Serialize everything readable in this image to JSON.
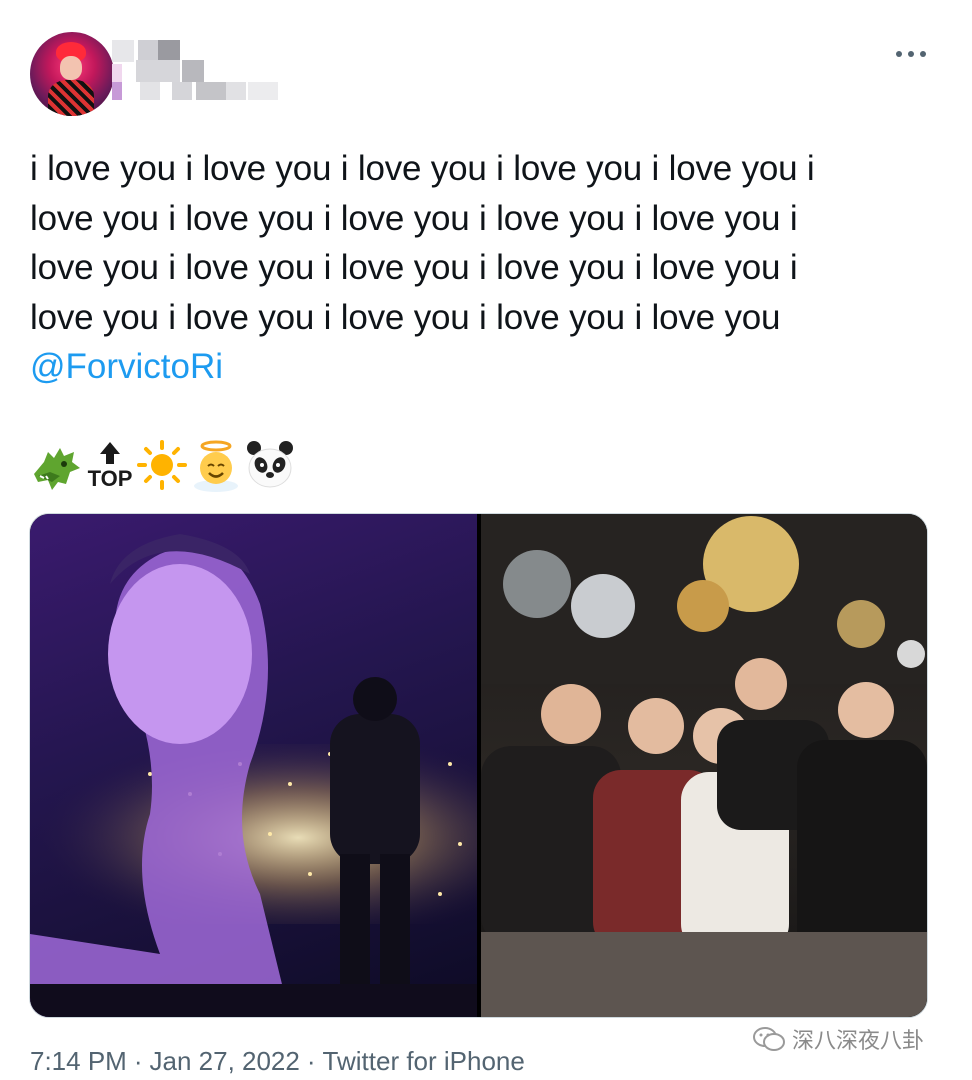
{
  "tweet": {
    "text_lines": [
      "i love you i love you i love you i love you i love you i",
      "love you i love you i love you i love you i love you i",
      "love you i love you i love you i love you i love you i",
      "love you i love you i love you i love you i love you"
    ],
    "mention": "@ForvictoRi",
    "emojis": [
      "dragon-face",
      "top-arrow",
      "sun",
      "angel-face",
      "panda-face"
    ],
    "emoji_top_label": "TOP",
    "time": "7:14 PM",
    "separator": "·",
    "date": "Jan 27, 2022",
    "source": "Twitter for iPhone"
  },
  "watermark": {
    "text": "深八深夜八卦"
  },
  "colors": {
    "text": "#0f1419",
    "link": "#1d9bf0",
    "secondary": "#536471",
    "border": "#cfd9de"
  }
}
